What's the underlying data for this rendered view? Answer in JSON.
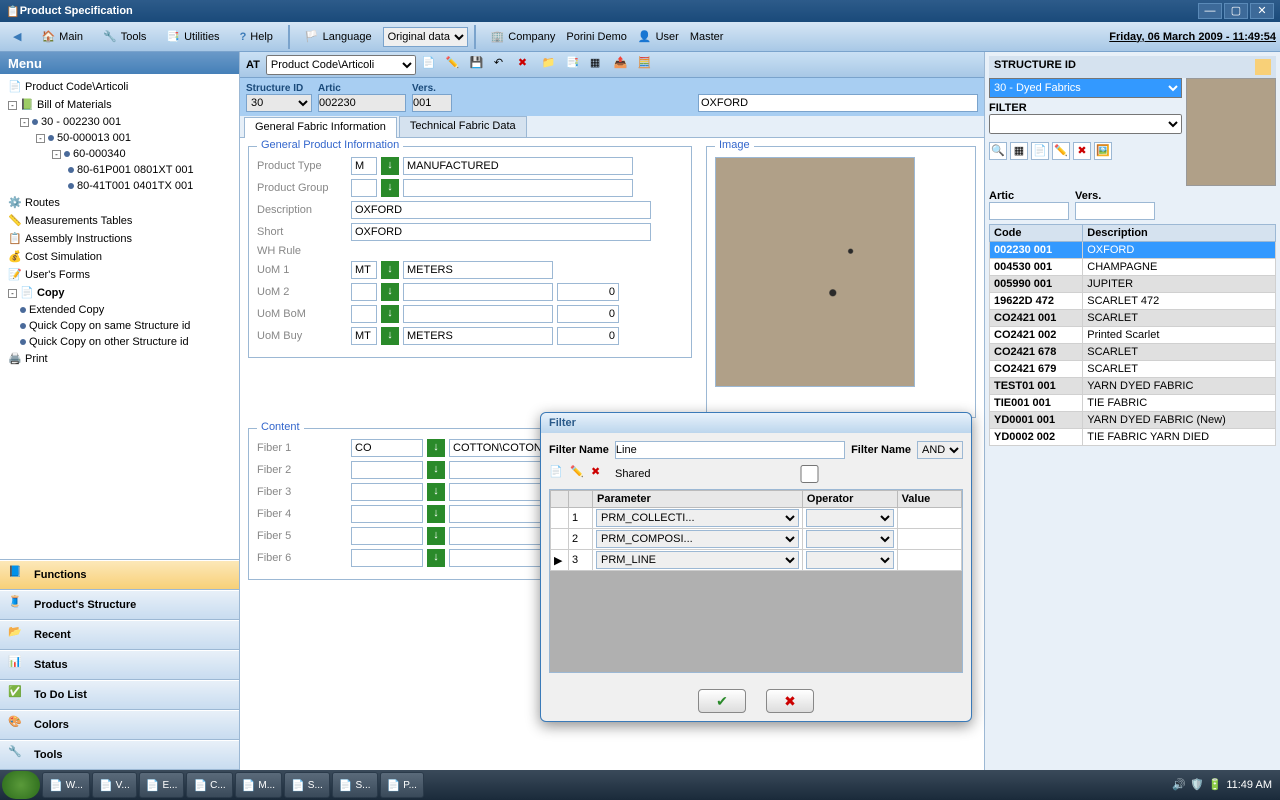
{
  "window": {
    "title": "Product Specification"
  },
  "toolbar": {
    "main": "Main",
    "tools": "Tools",
    "utilities": "Utilities",
    "help": "Help",
    "language": "Language",
    "language_sel": "Original data",
    "company": "Company",
    "company_val": "Porini Demo",
    "user": "User",
    "user_val": "Master",
    "datetime": "Friday, 06 March 2009 - 11:49:54"
  },
  "menu_title": "Menu",
  "tree": {
    "product_code": "Product Code\\Articoli",
    "bom": "Bill of Materials",
    "n30": "30 - 002230 001",
    "n50": "50-000013 001",
    "n60": "60-000340",
    "n80a": "80-61P001 0801XT 001",
    "n80b": "80-41T001 0401TX 001",
    "routes": "Routes",
    "meas": "Measurements Tables",
    "assy": "Assembly Instructions",
    "cost": "Cost Simulation",
    "forms": "User's Forms",
    "copy": "Copy",
    "ext_copy": "Extended Copy",
    "qc_same": "Quick Copy on same Structure id",
    "qc_other": "Quick Copy on other Structure id",
    "print": "Print"
  },
  "stack": {
    "functions": "Functions",
    "structure": "Product's Structure",
    "recent": "Recent",
    "status": "Status",
    "todo": "To Do List",
    "colors": "Colors",
    "tools": "Tools"
  },
  "at": {
    "label": "AT",
    "path": "Product Code\\Articoli"
  },
  "hdr": {
    "struct_lbl": "Structure ID",
    "struct": "30",
    "artic_lbl": "Artic",
    "artic": "002230",
    "vers_lbl": "Vers.",
    "vers": "001",
    "name": "OXFORD"
  },
  "tabs": {
    "general": "General Fabric Information",
    "tech": "Technical Fabric Data"
  },
  "gpi": {
    "title": "General Product Information",
    "ptype_lbl": "Product Type",
    "ptype": "M",
    "ptype_desc": "MANUFACTURED",
    "pgroup_lbl": "Product Group",
    "desc_lbl": "Description",
    "desc": "OXFORD",
    "short_lbl": "Short",
    "short": "OXFORD",
    "wh_lbl": "WH Rule",
    "uom1_lbl": "UoM 1",
    "uom1": "MT",
    "uom1_desc": "METERS",
    "uom2_lbl": "UoM 2",
    "uom2_qty": "0",
    "uombom_lbl": "UoM BoM",
    "uombom_qty": "0",
    "uombuy_lbl": "UoM Buy",
    "uombuy": "MT",
    "uombuy_desc": "METERS",
    "uombuy_qty": "0"
  },
  "image_title": "Image",
  "content": {
    "title": "Content",
    "f1_lbl": "Fiber 1",
    "f1": "CO",
    "f1_desc": "COTTON\\COTON",
    "f2_lbl": "Fiber 2",
    "f3_lbl": "Fiber 3",
    "f4_lbl": "Fiber 4",
    "f5_lbl": "Fiber 5",
    "f6_lbl": "Fiber 6"
  },
  "right": {
    "struct_lbl": "STRUCTURE ID",
    "struct_sel": "30 - Dyed Fabrics",
    "filter_lbl": "FILTER",
    "artic_lbl": "Artic",
    "vers_lbl": "Vers.",
    "code_hdr": "Code",
    "desc_hdr": "Description",
    "rows": [
      {
        "code": "002230 001",
        "desc": "OXFORD"
      },
      {
        "code": "004530 001",
        "desc": "CHAMPAGNE"
      },
      {
        "code": "005990 001",
        "desc": "JUPITER"
      },
      {
        "code": "19622D 472",
        "desc": "SCARLET 472"
      },
      {
        "code": "CO2421 001",
        "desc": "SCARLET"
      },
      {
        "code": "CO2421 002",
        "desc": "Printed Scarlet"
      },
      {
        "code": "CO2421 678",
        "desc": "SCARLET"
      },
      {
        "code": "CO2421 679",
        "desc": "SCARLET"
      },
      {
        "code": "TEST01 001",
        "desc": "YARN DYED FABRIC"
      },
      {
        "code": "TIE001 001",
        "desc": "TIE FABRIC"
      },
      {
        "code": "YD0001 001",
        "desc": "YARN DYED FABRIC (New)"
      },
      {
        "code": "YD0002 002",
        "desc": "TIE FABRIC YARN DIED"
      }
    ]
  },
  "dialog": {
    "title": "Filter",
    "name_lbl": "Filter Name",
    "name": "Line",
    "name2_lbl": "Filter Name",
    "logic": "AND",
    "shared_lbl": "Shared",
    "param_hdr": "Parameter",
    "op_hdr": "Operator",
    "val_hdr": "Value",
    "rows": [
      {
        "n": "1",
        "p": "PRM_COLLECTI..."
      },
      {
        "n": "2",
        "p": "PRM_COMPOSI..."
      },
      {
        "n": "3",
        "p": "PRM_LINE"
      }
    ]
  },
  "taskbar": {
    "items": [
      "W...",
      "V...",
      "E...",
      "C...",
      "M...",
      "S...",
      "S...",
      "P..."
    ],
    "time": "11:49 AM"
  }
}
